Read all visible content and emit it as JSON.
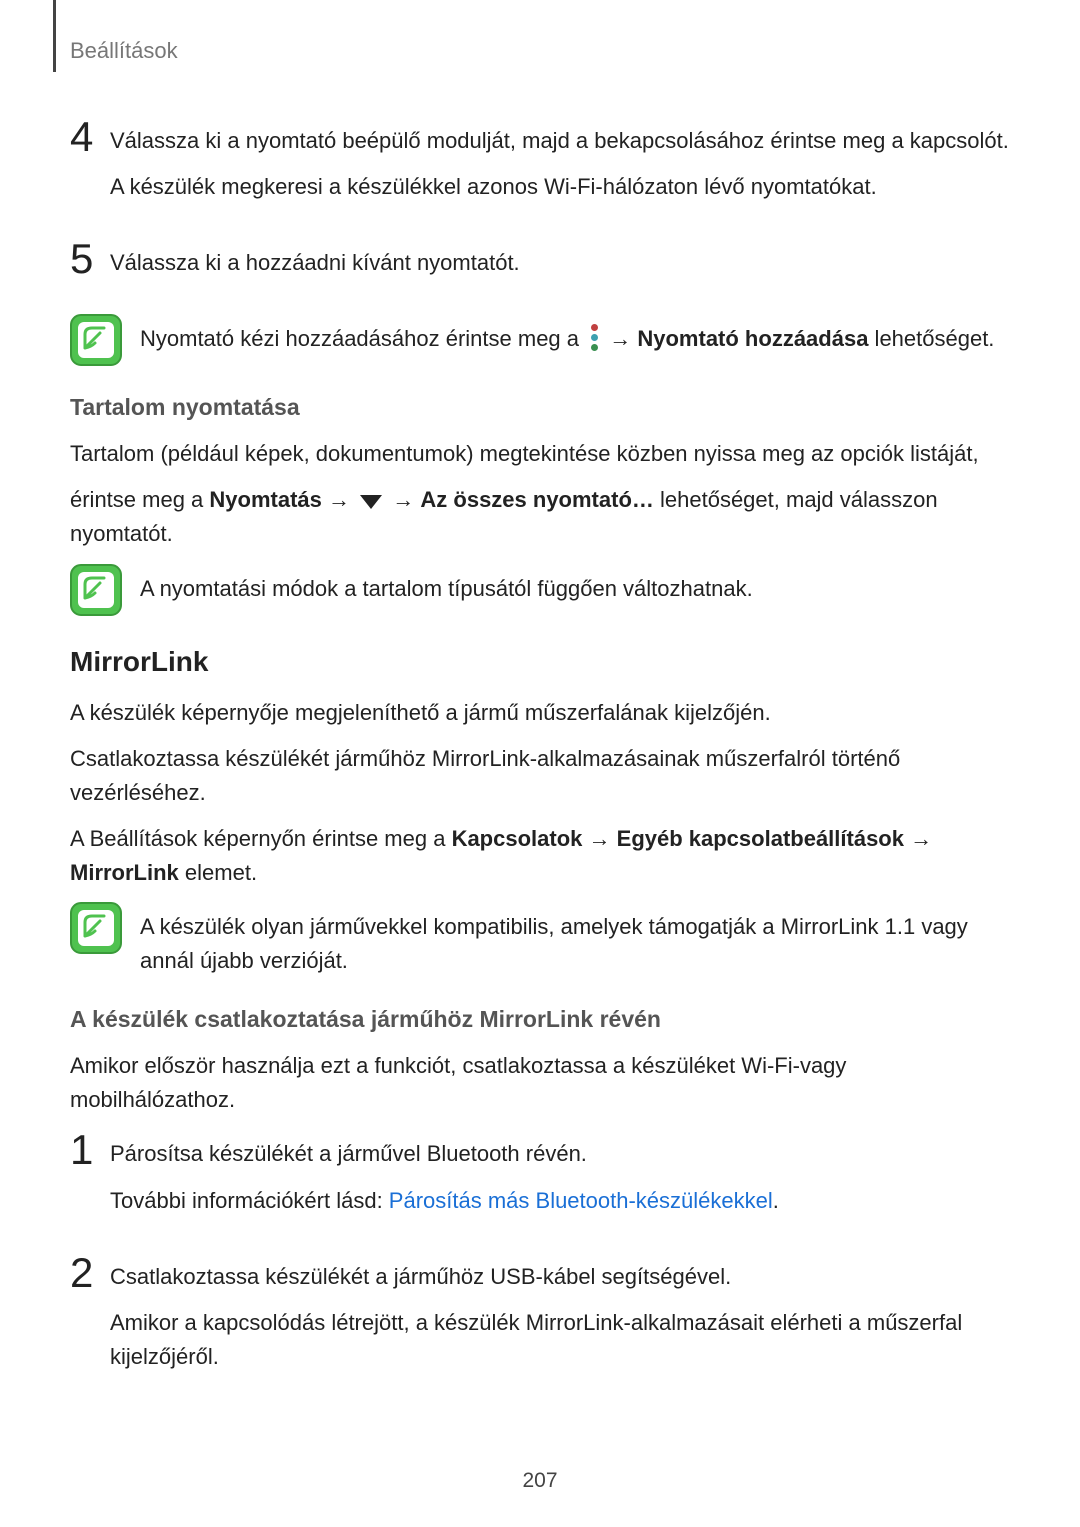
{
  "header": {
    "title": "Beállítások"
  },
  "step4": {
    "num": "4",
    "line1": "Válassza ki a nyomtató beépülő modulját, majd a bekapcsolásához érintse meg a kapcsolót.",
    "line2": "A készülék megkeresi a készülékkel azonos Wi-Fi-hálózaton lévő nyomtatókat."
  },
  "step5": {
    "num": "5",
    "line1": "Válassza ki a hozzáadni kívánt nyomtatót."
  },
  "note1": {
    "pre": "Nyomtató kézi hozzáadásához érintse meg a ",
    "arrow": "→",
    "bold": "Nyomtató hozzáadása",
    "post": " lehetőséget."
  },
  "sub1": {
    "title": "Tartalom nyomtatása"
  },
  "para1": {
    "line1": "Tartalom (például képek, dokumentumok) megtekintése közben nyissa meg az opciók listáját,",
    "pre": "érintse meg a ",
    "b1": "Nyomtatás",
    "arrow1": "→",
    "arrow2": "→",
    "b2": "Az összes nyomtató…",
    "post": " lehetőséget, majd válasszon nyomtatót."
  },
  "note2": {
    "text": "A nyomtatási módok a tartalom típusától függően változhatnak."
  },
  "mirror": {
    "heading": "MirrorLink",
    "p1": "A készülék képernyője megjeleníthető a jármű műszerfalának kijelzőjén.",
    "p2": "Csatlakoztassa készülékét járműhöz MirrorLink-alkalmazásainak műszerfalról történő vezérléséhez.",
    "p3_pre": "A Beállítások képernyőn érintse meg a ",
    "p3_b1": "Kapcsolatok",
    "p3_arrow1": "→",
    "p3_b2": "Egyéb kapcsolatbeállítások",
    "p3_arrow2": "→",
    "p3_b3": "MirrorLink",
    "p3_post": "elemet."
  },
  "note3": {
    "text": "A készülék olyan járművekkel kompatibilis, amelyek támogatják a MirrorLink 1.1 vagy annál újabb verzióját."
  },
  "sub2": {
    "title": "A készülék csatlakoztatása járműhöz MirrorLink révén"
  },
  "para2": "Amikor először használja ezt a funkciót, csatlakoztassa a készüléket Wi-Fi-vagy mobilhálózathoz.",
  "step1b": {
    "num": "1",
    "line1": "Párosítsa készülékét a járművel Bluetooth révén.",
    "line2_pre": "További információkért lásd: ",
    "line2_link": "Párosítás más Bluetooth-készülékekkel",
    "line2_post": "."
  },
  "step2b": {
    "num": "2",
    "line1": "Csatlakoztassa készülékét a járműhöz USB-kábel segítségével.",
    "line2": "Amikor a kapcsolódás létrejött, a készülék MirrorLink-alkalmazásait elérheti a műszerfal kijelzőjéről."
  },
  "page_number": "207"
}
